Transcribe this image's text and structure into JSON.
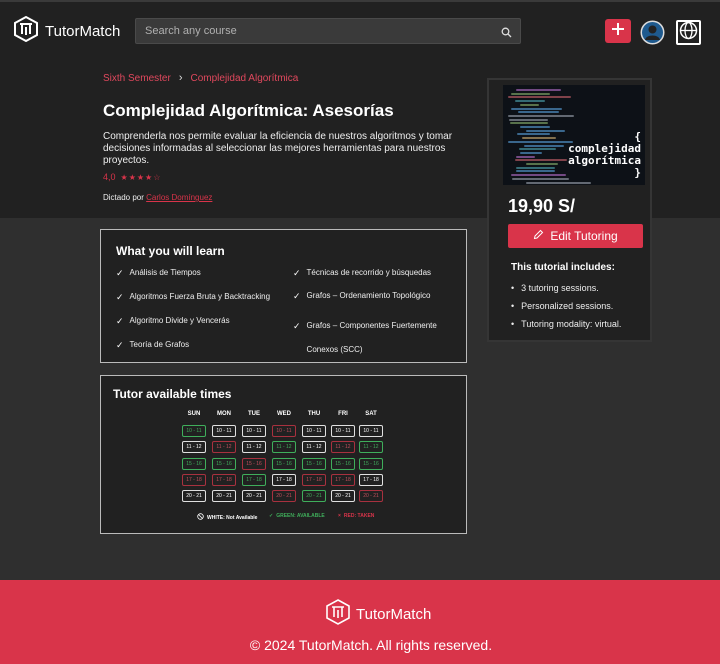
{
  "header": {
    "brand": "TutorMatch",
    "search_placeholder": "Search any course"
  },
  "breadcrumb": {
    "parent": "Sixth Semester",
    "current": "Complejidad Algorítmica"
  },
  "course": {
    "title": "Complejidad Algorítmica: Asesorías",
    "description": "Comprenderla nos permite evaluar la eficiencia de nuestros algoritmos y tomar decisiones informadas al seleccionar las mejores herramientas para nuestros proyectos.",
    "rating": "4,0",
    "rating_value": 4,
    "rating_max": 5,
    "taught_by_label": "Dictado por",
    "tutor_name": "Carlos Domínguez"
  },
  "card": {
    "thumbnail_text_1": "{",
    "thumbnail_text_2": "complejidad",
    "thumbnail_text_3": "algorítmica",
    "thumbnail_text_4": "}",
    "price": "19,90 S/",
    "edit_label": "Edit Tutoring",
    "includes_title": "This tutorial includes:",
    "includes": [
      "3 tutoring sessions.",
      "Personalized sessions.",
      "Tutoring modality: virtual."
    ]
  },
  "learn": {
    "title": "What you will learn",
    "items": [
      "Análisis de Tiempos",
      "Técnicas de recorrido y búsquedas",
      "Algoritmos Fuerza Bruta y Backtracking",
      "Grafos – Ordenamiento Topológico",
      "Algoritmo Divide y Vencerás",
      "Grafos – Componentes Fuertemente Conexos (SCC)",
      "Teoría de Grafos"
    ]
  },
  "schedule": {
    "title": "Tutor available times",
    "days": [
      "SUN",
      "MON",
      "TUE",
      "WED",
      "THU",
      "FRI",
      "SAT"
    ],
    "slots": [
      "10 - 11",
      "11 - 12",
      "15 - 16",
      "17 - 18",
      "20 - 21"
    ],
    "status": [
      [
        "green",
        "white",
        "white",
        "red",
        "white",
        "white",
        "white"
      ],
      [
        "white",
        "red",
        "white",
        "green",
        "white",
        "red",
        "green"
      ],
      [
        "green",
        "green",
        "red",
        "green",
        "green",
        "green",
        "green"
      ],
      [
        "red",
        "red",
        "green",
        "white",
        "red",
        "red",
        "white"
      ],
      [
        "white",
        "white",
        "white",
        "red",
        "green",
        "white",
        "red"
      ]
    ],
    "legend": {
      "white": "WHITE: Not Available",
      "green": "GREEN: AVAILABLE",
      "red": "RED: TAKEN"
    }
  },
  "footer": {
    "brand": "TutorMatch",
    "copyright": "© 2024 TutorMatch. All rights reserved."
  },
  "colors": {
    "accent": "#d9344a",
    "available": "#3fae5b",
    "taken": "#a8313f",
    "background": "#2f2f2f",
    "panel": "#212121"
  }
}
